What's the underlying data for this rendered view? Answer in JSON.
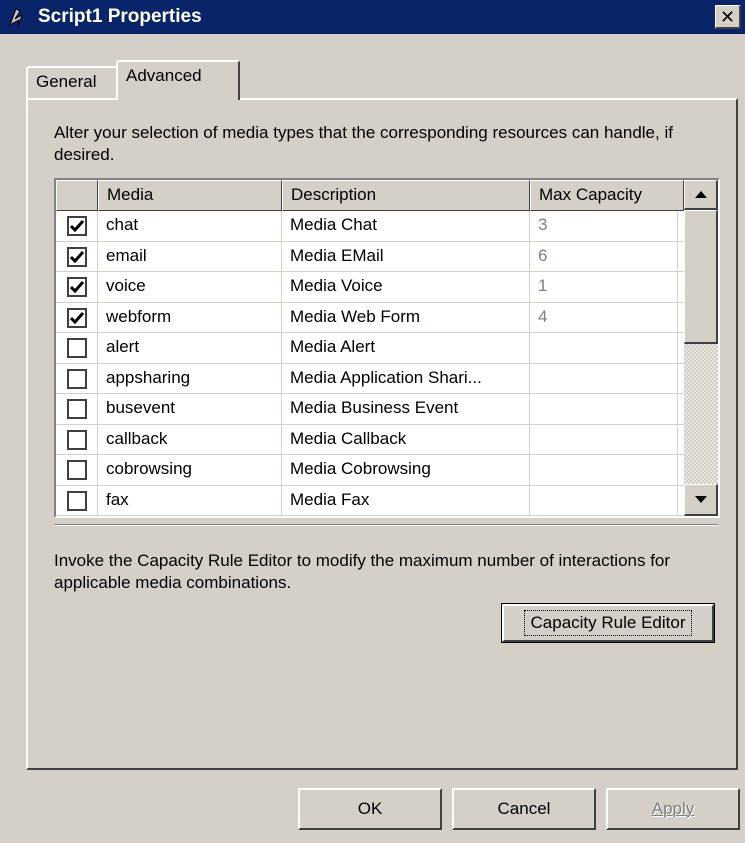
{
  "window": {
    "title": "Script1 Properties",
    "close_symbol": "✕",
    "icon": "script-icon"
  },
  "tabs": [
    {
      "label": "General",
      "active": false
    },
    {
      "label": "Advanced",
      "active": true
    }
  ],
  "advanced": {
    "intro": "Alter your selection of media types that the corresponding resources can handle, if desired.",
    "grid": {
      "columns": [
        "Media",
        "Description",
        "Max Capacity"
      ],
      "rows": [
        {
          "checked": true,
          "media": "chat",
          "description": "Media Chat",
          "max_capacity": "3"
        },
        {
          "checked": true,
          "media": "email",
          "description": "Media EMail",
          "max_capacity": "6"
        },
        {
          "checked": true,
          "media": "voice",
          "description": "Media Voice",
          "max_capacity": "1"
        },
        {
          "checked": true,
          "media": "webform",
          "description": "Media Web Form",
          "max_capacity": "4"
        },
        {
          "checked": false,
          "media": "alert",
          "description": "Media Alert",
          "max_capacity": ""
        },
        {
          "checked": false,
          "media": "appsharing",
          "description": "Media Application Shari...",
          "max_capacity": ""
        },
        {
          "checked": false,
          "media": "busevent",
          "description": "Media Business Event",
          "max_capacity": ""
        },
        {
          "checked": false,
          "media": "callback",
          "description": "Media Callback",
          "max_capacity": ""
        },
        {
          "checked": false,
          "media": "cobrowsing",
          "description": "Media Cobrowsing",
          "max_capacity": ""
        },
        {
          "checked": false,
          "media": "fax",
          "description": "Media Fax",
          "max_capacity": ""
        }
      ]
    },
    "rule_text": "Invoke the Capacity Rule Editor to modify the maximum number of interactions for applicable media combinations.",
    "capacity_button": "Capacity Rule Editor"
  },
  "footer": {
    "ok": "OK",
    "cancel": "Cancel",
    "apply": "Apply",
    "apply_enabled": false
  }
}
